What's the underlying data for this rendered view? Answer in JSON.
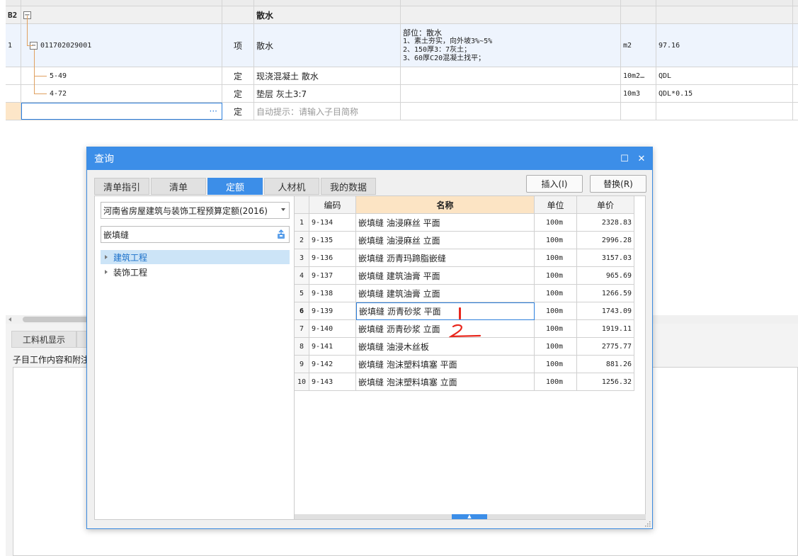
{
  "background": {
    "group_row": {
      "id": "B2",
      "name": "散水"
    },
    "rows": [
      {
        "num": "1",
        "code": "011702029001",
        "type": "项",
        "name": "散水",
        "features": [
          "部位：散水",
          "1、素土夯实，向外坡3%~5%",
          "2、150厚3：7灰土；",
          "3、60厚C20混凝土找平；"
        ],
        "unit": "m2",
        "quantity": "97.16"
      },
      {
        "num": "",
        "code": "5-49",
        "type": "定",
        "name": "现浇混凝土 散水",
        "unit": "10m2…",
        "quantity": "QDL"
      },
      {
        "num": "",
        "code": "4-72",
        "type": "定",
        "name": "垫层 灰土3:7",
        "unit": "10m3",
        "quantity": "QDL*0.15"
      }
    ],
    "input_row": {
      "ellipsis": "···",
      "type": "定",
      "hint": "自动提示：请输入子目简称"
    },
    "lower_tabs": [
      "工料机显示",
      ""
    ],
    "lower_label": "子目工作内容和附注"
  },
  "dialog": {
    "title": "查询",
    "title_buttons": {
      "maximize": "☐",
      "close": "✕"
    },
    "tabs": [
      {
        "label": "清单指引",
        "active": false
      },
      {
        "label": "清单",
        "active": false
      },
      {
        "label": "定额",
        "active": true
      },
      {
        "label": "人材机",
        "active": false
      },
      {
        "label": "我的数据",
        "active": false
      }
    ],
    "insert_label": "插入(I)",
    "replace_label": "替换(R)",
    "quota_select_value": "河南省房屋建筑与装饰工程预算定额(2016)",
    "search_value": "嵌填缝",
    "tree": [
      {
        "label": "建筑工程",
        "selected": true
      },
      {
        "label": "装饰工程",
        "selected": false
      }
    ],
    "table": {
      "headers": {
        "code": "编码",
        "name": "名称",
        "unit": "单位",
        "price": "单价"
      },
      "current_row": 6,
      "rows": [
        {
          "idx": "1",
          "code": "9-134",
          "name": "嵌填缝 油浸麻丝 平面",
          "unit": "100m",
          "price": "2328.83"
        },
        {
          "idx": "2",
          "code": "9-135",
          "name": "嵌填缝 油浸麻丝 立面",
          "unit": "100m",
          "price": "2996.28"
        },
        {
          "idx": "3",
          "code": "9-136",
          "name": "嵌填缝 沥青玛蹄脂嵌缝",
          "unit": "100m",
          "price": "3157.03"
        },
        {
          "idx": "4",
          "code": "9-137",
          "name": "嵌填缝 建筑油膏 平面",
          "unit": "100m",
          "price": "965.69"
        },
        {
          "idx": "5",
          "code": "9-138",
          "name": "嵌填缝 建筑油膏 立面",
          "unit": "100m",
          "price": "1266.59"
        },
        {
          "idx": "6",
          "code": "9-139",
          "name": "嵌填缝 沥青砂浆 平面",
          "unit": "100m",
          "price": "1743.09"
        },
        {
          "idx": "7",
          "code": "9-140",
          "name": "嵌填缝 沥青砂浆 立面",
          "unit": "100m",
          "price": "1919.11"
        },
        {
          "idx": "8",
          "code": "9-141",
          "name": "嵌填缝 油浸木丝板",
          "unit": "100m",
          "price": "2775.77"
        },
        {
          "idx": "9",
          "code": "9-142",
          "name": "嵌填缝 泡沫塑料填塞 平面",
          "unit": "100m",
          "price": "881.26"
        },
        {
          "idx": "10",
          "code": "9-143",
          "name": "嵌填缝 泡沫塑料填塞 立面",
          "unit": "100m",
          "price": "1256.32"
        }
      ]
    },
    "annotations": {
      "mark_1": "1",
      "mark_2": "2",
      "color": "#e8261c"
    },
    "bottom_grip": "▲"
  }
}
